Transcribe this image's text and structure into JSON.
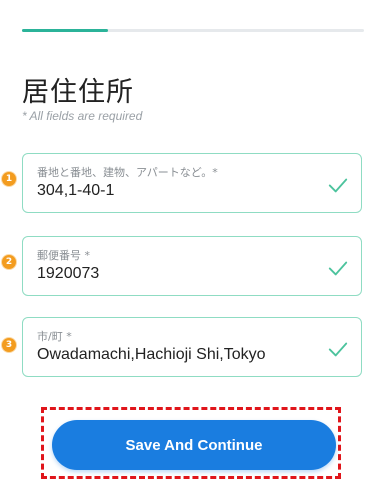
{
  "progress": {
    "fraction": 0.25,
    "color": "#2bb399"
  },
  "header": {
    "title": "居住住所",
    "subtitle": "* All fields are required"
  },
  "fields": [
    {
      "step": "1",
      "label": "番地と番地、建物、アパートなど。*",
      "value": "304,1-40-1"
    },
    {
      "step": "2",
      "label": "郵便番号 *",
      "value": "1920073"
    },
    {
      "step": "3",
      "label": "市/町 *",
      "value": "Owadamachi,Hachioji Shi,Tokyo"
    }
  ],
  "action": {
    "label": "Save And Continue",
    "color": "#1a7de0"
  },
  "colors": {
    "field_border": "#8fdcc3",
    "check": "#4cc39d",
    "badge": "#f39c1f",
    "highlight": "#e0151b"
  },
  "icons": {
    "check": "check-icon"
  }
}
